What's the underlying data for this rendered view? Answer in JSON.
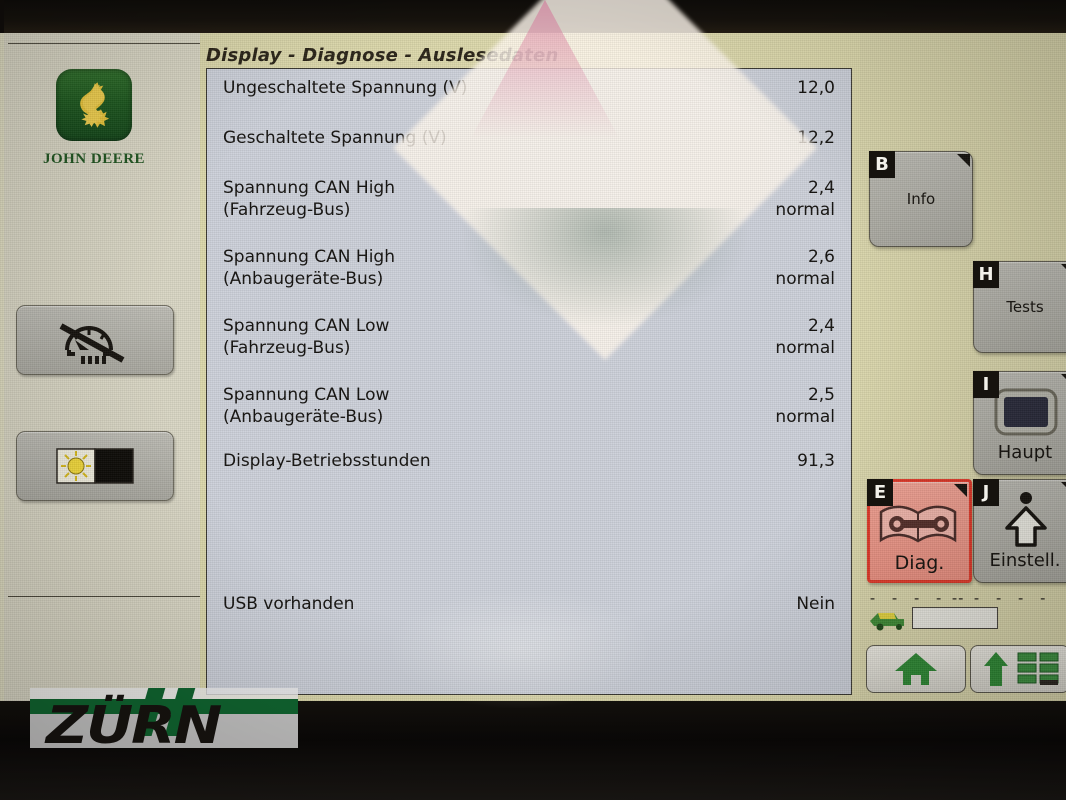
{
  "window": {
    "title": "Display - Diagnose - Auslesedaten"
  },
  "brand": {
    "name": "JOHN DEERE",
    "logo_icon": "john-deere-deer-logo",
    "green": "#1f5520"
  },
  "watermark": {
    "text": "ZÜRN",
    "bar_color": "#10632f"
  },
  "sidebar": {
    "buttons": [
      {
        "icon": "gauge-disabled-icon",
        "label": ""
      },
      {
        "icon": "day-night-toggle-icon",
        "label": ""
      }
    ]
  },
  "table": {
    "rows": [
      {
        "label": "Ungeschaltete Spannung (V)",
        "value": "12,0",
        "status": ""
      },
      {
        "label": "Geschaltete Spannung (V)",
        "value": "12,2",
        "status": ""
      },
      {
        "label": "Spannung CAN High\n(Fahrzeug-Bus)",
        "value": "2,4",
        "status": "normal"
      },
      {
        "label": "Spannung CAN High\n(Anbaugeräte-Bus)",
        "value": "2,6",
        "status": "normal"
      },
      {
        "label": "Spannung CAN Low\n(Fahrzeug-Bus)",
        "value": "2,4",
        "status": "normal"
      },
      {
        "label": "Spannung CAN Low\n(Anbaugeräte-Bus)",
        "value": "2,5",
        "status": "normal"
      },
      {
        "label": "Display-Betriebsstunden",
        "value": "91,3",
        "status": ""
      },
      {
        "label": "USB vorhanden",
        "value": "Nein",
        "status": ""
      }
    ]
  },
  "softkeys": [
    {
      "badge": "B",
      "label": "Info",
      "icon": "none",
      "selected": false
    },
    {
      "badge": "H",
      "label": "Tests",
      "icon": "none",
      "selected": false
    },
    {
      "badge": "I",
      "label": "Haupt",
      "icon": "display-icon",
      "selected": false
    },
    {
      "badge": "E",
      "label": "Diag.",
      "icon": "book-wrench-icon",
      "selected": true
    },
    {
      "badge": "J",
      "label": "Einstell.",
      "icon": "up-arrow-dot-icon",
      "selected": false
    }
  ],
  "status_bar": {
    "left_dashes": "- - - - -",
    "right_dashes": "- - - - -",
    "machine_icon": "combine-icon",
    "field_value": ""
  },
  "nav": {
    "home_icon": "home-icon",
    "home_label": "",
    "list_icon": "up-arrow-list-icon",
    "list_label": ""
  },
  "colors": {
    "screen_bg": "#dedbc0",
    "panel_bg": "#dcd8ab",
    "list_bg": "#cdd1da",
    "right_bg": "#d9d5ab",
    "selected_key": "#e03a2a",
    "accent_green": "#1f5520"
  }
}
